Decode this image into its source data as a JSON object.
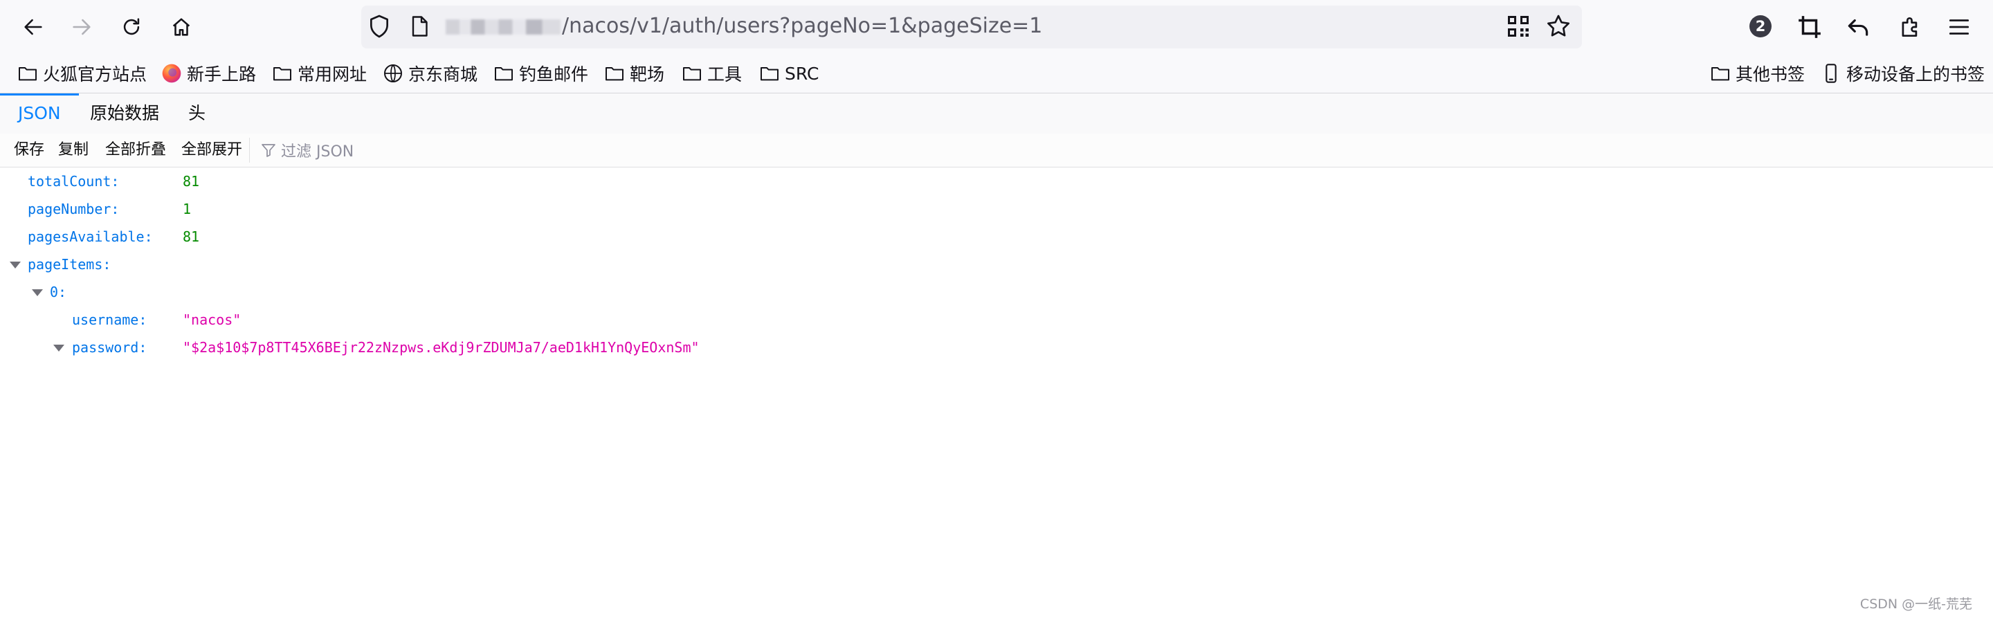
{
  "browser": {
    "url_visible": "/nacos/v1/auth/users?pageNo=1&pageSize=1",
    "extension_badge": "2"
  },
  "bookmarks": {
    "left": [
      "火狐官方站点",
      "新手上路",
      "常用网址",
      "京东商城",
      "钓鱼邮件",
      "靶场",
      "工具",
      "SRC"
    ],
    "right": [
      "其他书签",
      "移动设备上的书签"
    ]
  },
  "viewer": {
    "tabs": [
      "JSON",
      "原始数据",
      "头"
    ],
    "active_tab": "JSON",
    "toolbar": {
      "save": "保存",
      "copy": "复制",
      "collapse_all": "全部折叠",
      "expand_all": "全部展开"
    },
    "filter_placeholder": "过滤 JSON"
  },
  "json": {
    "totalCount_key": "totalCount:",
    "totalCount": "81",
    "pageNumber_key": "pageNumber:",
    "pageNumber": "1",
    "pagesAvailable_key": "pagesAvailable:",
    "pagesAvailable": "81",
    "pageItems_key": "pageItems:",
    "index_key": "0:",
    "username_key": "username:",
    "username": "\"nacos\"",
    "password_key": "password:",
    "password": "\"$2a$10$7p8TT45X6BEjr22zNzpws.eKdj9rZDUMJa7/aeD1kH1YnQyEOxnSm\""
  },
  "watermark": "CSDN @一纸-荒芜",
  "colors": {
    "key": "#0074e8",
    "number": "#058b00",
    "string": "#dd00a9",
    "accent": "#0a84ff"
  }
}
